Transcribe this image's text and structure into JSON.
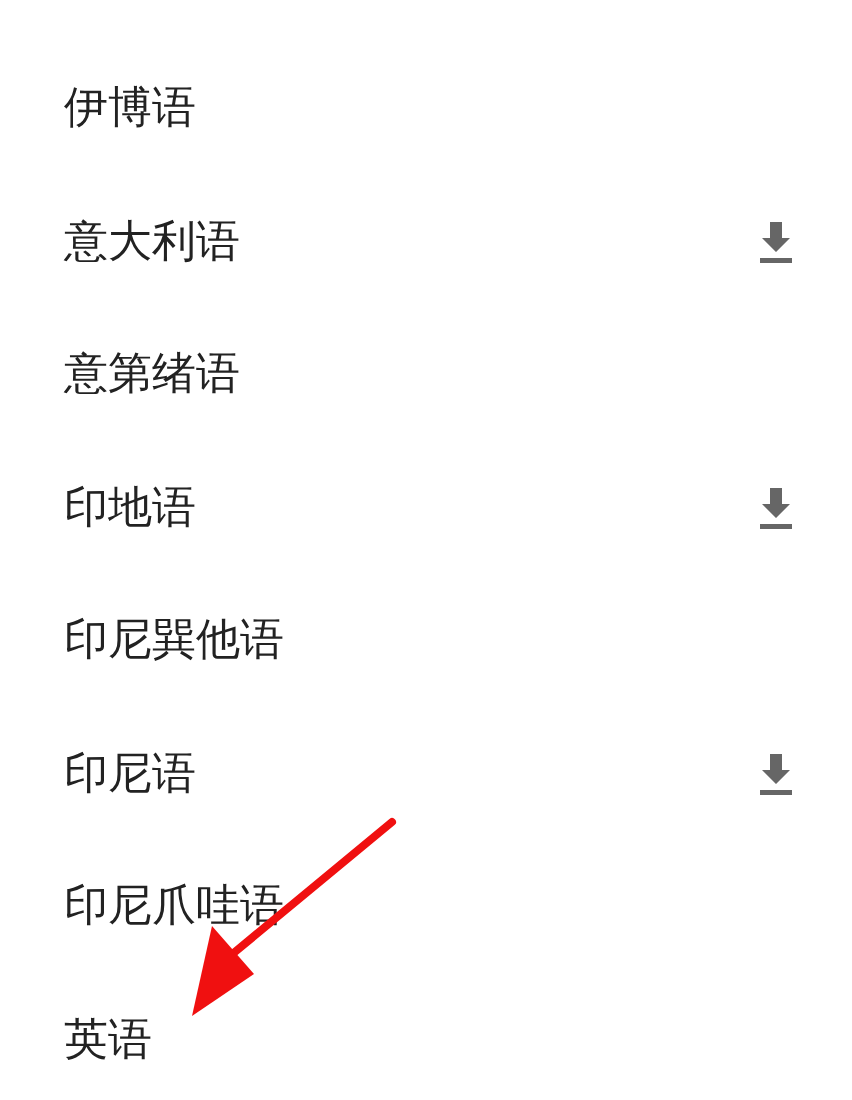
{
  "languages": [
    {
      "name": "伊博语",
      "downloadable": false
    },
    {
      "name": "意大利语",
      "downloadable": true
    },
    {
      "name": "意第绪语",
      "downloadable": false
    },
    {
      "name": "印地语",
      "downloadable": true
    },
    {
      "name": "印尼巽他语",
      "downloadable": false
    },
    {
      "name": "印尼语",
      "downloadable": true
    },
    {
      "name": "印尼爪哇语",
      "downloadable": false
    },
    {
      "name": "英语",
      "downloadable": false
    }
  ]
}
